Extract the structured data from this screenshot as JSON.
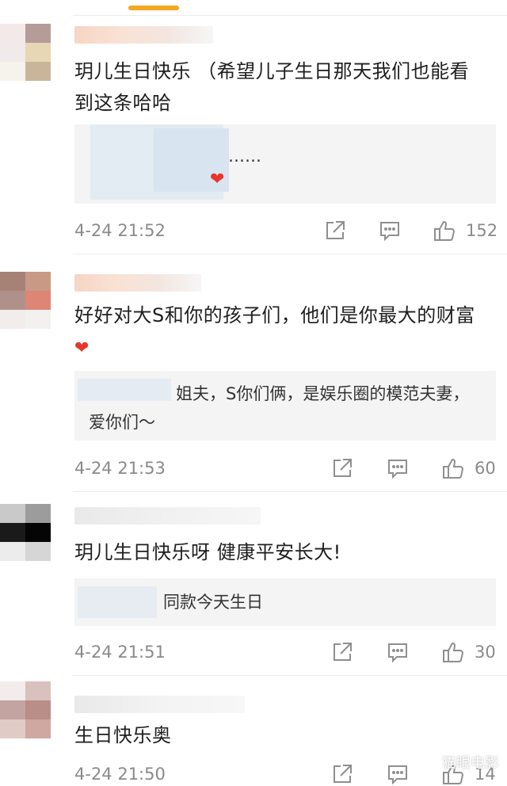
{
  "comments": [
    {
      "text": "玥儿生日快乐 （希望儿子生日那天我们也能看到这条哈哈",
      "reply_text": "……",
      "timestamp": "4-24 21:52",
      "likes": "152"
    },
    {
      "text": "好好对大S和你的孩子们，他们是你最大的财富",
      "reply_text": "姐夫，S你们俩，是娱乐圈的模范夫妻，爱你们～",
      "timestamp": "4-24 21:53",
      "likes": "60"
    },
    {
      "text": "玥儿生日快乐呀 健康平安长大!",
      "reply_text": "同款今天生日",
      "timestamp": "4-24 21:51",
      "likes": "30"
    },
    {
      "text": "生日快乐奥",
      "timestamp": "4-24 21:50",
      "likes": "14"
    }
  ],
  "icons": {
    "share": "share-icon",
    "comment": "comment-icon",
    "like": "thumbs-up-icon"
  },
  "watermark": "猫眼电影",
  "colors": {
    "accent": "#f5a623",
    "heart": "#e8342a",
    "meta": "#8a8a8a",
    "quote_bg": "#f4f4f4"
  }
}
